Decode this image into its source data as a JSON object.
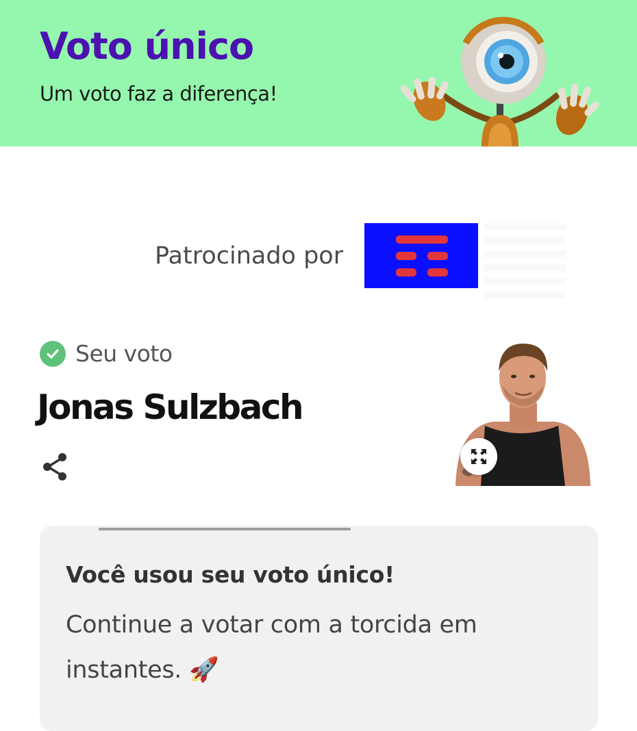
{
  "header": {
    "title": "Voto único",
    "subtitle": "Um voto faz a diferença!",
    "background_color": "#95f7ad",
    "title_color": "#4b12b0",
    "mascot_icon": "big-brother-eye-robot-mascot"
  },
  "sponsor": {
    "label": "Patrocinado por",
    "logo_icon": "sponsor-logo-red-bars-on-blue",
    "logo_background": "#0a10ff",
    "logo_bar_color": "#e2363a"
  },
  "vote": {
    "status_label": "Seu voto",
    "status_icon": "check-circle-icon",
    "status_color": "#5ec27a",
    "candidate_name": "Jonas Sulzbach",
    "share_icon": "share-icon",
    "photo": "candidate-photo",
    "expand_icon": "expand-icon"
  },
  "message": {
    "title": "Você usou seu voto único!",
    "body_line1": "Continue a votar com a torcida em",
    "body_line2": "instantes.",
    "emoji": "🚀"
  }
}
